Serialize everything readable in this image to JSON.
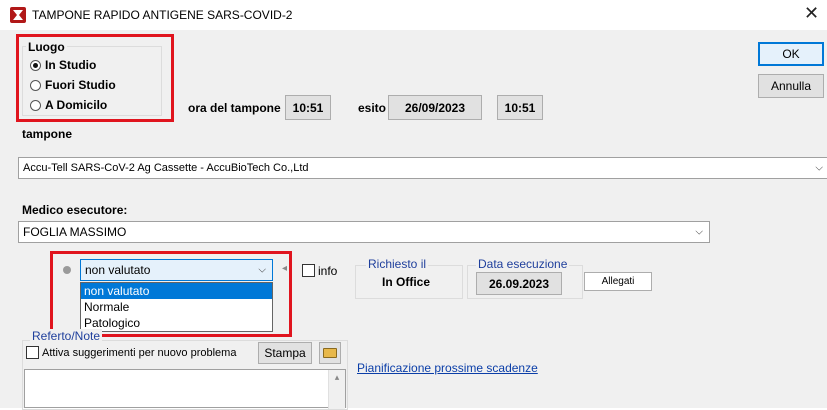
{
  "window": {
    "title": "TAMPONE RAPIDO ANTIGENE SARS-COVID-2",
    "close_glyph": "✕"
  },
  "buttons": {
    "ok": "OK",
    "cancel": "Annulla",
    "stampa": "Stampa",
    "allegati": "Allegati"
  },
  "luogo": {
    "legend": "Luogo",
    "options": [
      {
        "label": "In Studio",
        "selected": true
      },
      {
        "label": "Fuori Studio",
        "selected": false
      },
      {
        "label": "A Domicilo",
        "selected": false
      }
    ]
  },
  "times": {
    "ora_label": "ora del tampone",
    "ora_value": "10:51",
    "esito_label": "esito",
    "esito_date": "26/09/2023",
    "esito_time": "10:51"
  },
  "tampone": {
    "label": "tampone",
    "value": "Accu-Tell SARS-CoV-2 Ag Cassette - AccuBioTech Co.,Ltd"
  },
  "medico": {
    "label": "Medico esecutore:",
    "value": "FOGLIA MASSIMO"
  },
  "valutazione": {
    "selected": "non valutato",
    "options": [
      "non valutato",
      "Normale",
      "Patologico"
    ]
  },
  "info_label": "info",
  "richiesto": {
    "label": "Richiesto il",
    "value": "In Office"
  },
  "esecuzione": {
    "label": "Data esecuzione",
    "value": "26.09.2023"
  },
  "referto": {
    "label": "Referto/Note",
    "checkbox_label": "Attiva suggerimenti per nuovo problema"
  },
  "link": "Pianificazione prossime scadenze",
  "colors": {
    "highlight_red": "#e0141e",
    "selection_blue": "#0078d7",
    "link_blue": "#0b3ea8"
  },
  "icons": {
    "app": "app-logo-icon",
    "close": "close-icon",
    "folder": "open-folder-icon"
  }
}
